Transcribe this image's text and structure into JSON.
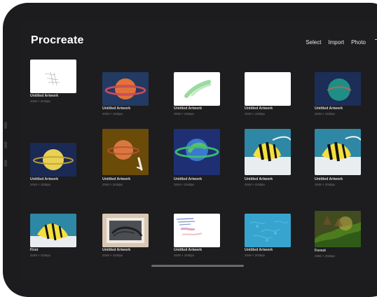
{
  "app": {
    "title": "Procreate"
  },
  "toolbar": {
    "select_label": "Select",
    "import_label": "Import",
    "photo_label": "Photo",
    "add_icon": "plus-icon"
  },
  "colors": {
    "background": "#1d1d1f",
    "text": "#ffffff",
    "subtext": "#7c7c7c"
  },
  "gallery": [
    {
      "title": "Untitled Artwork",
      "dims": "2048 × 2048px",
      "art": "sketch-white"
    },
    {
      "title": "Untitled Artwork",
      "dims": "2048 × 1536px",
      "art": "planet-orange-blue"
    },
    {
      "title": "Untitled Artwork",
      "dims": "2048 × 1536px",
      "art": "green-smudge"
    },
    {
      "title": "Untitled Artwork",
      "dims": "2048 × 1536px",
      "art": "blank"
    },
    {
      "title": "Untitled Artwork",
      "dims": "2048 × 1536px",
      "art": "teal-planet"
    },
    {
      "title": "Untitled Artwork",
      "dims": "2048 × 1536px",
      "art": "planet-yellow"
    },
    {
      "title": "Untitled Artwork",
      "dims": "2048 × 2048px",
      "art": "planet-brown-on-gold"
    },
    {
      "title": "Untitled Artwork",
      "dims": "2048 × 2048px",
      "art": "planet-green-blue"
    },
    {
      "title": "Untitled Artwork",
      "dims": "2048 × 2048px",
      "art": "fish"
    },
    {
      "title": "Untitled Artwork",
      "dims": "2048 × 2048px",
      "art": "fish"
    },
    {
      "title": "First",
      "dims": "2048 × 1536px",
      "art": "fish"
    },
    {
      "title": "Untitled Artwork",
      "dims": "2048 × 1536px",
      "art": "photo-stamp"
    },
    {
      "title": "Untitled Artwork",
      "dims": "2048 × 1536px",
      "art": "handwriting"
    },
    {
      "title": "Untitled Artwork",
      "dims": "2048 × 2048px",
      "art": "blue-pattern"
    },
    {
      "title": "Forest",
      "dims": "4096 × 2048px",
      "art": "forest"
    }
  ]
}
